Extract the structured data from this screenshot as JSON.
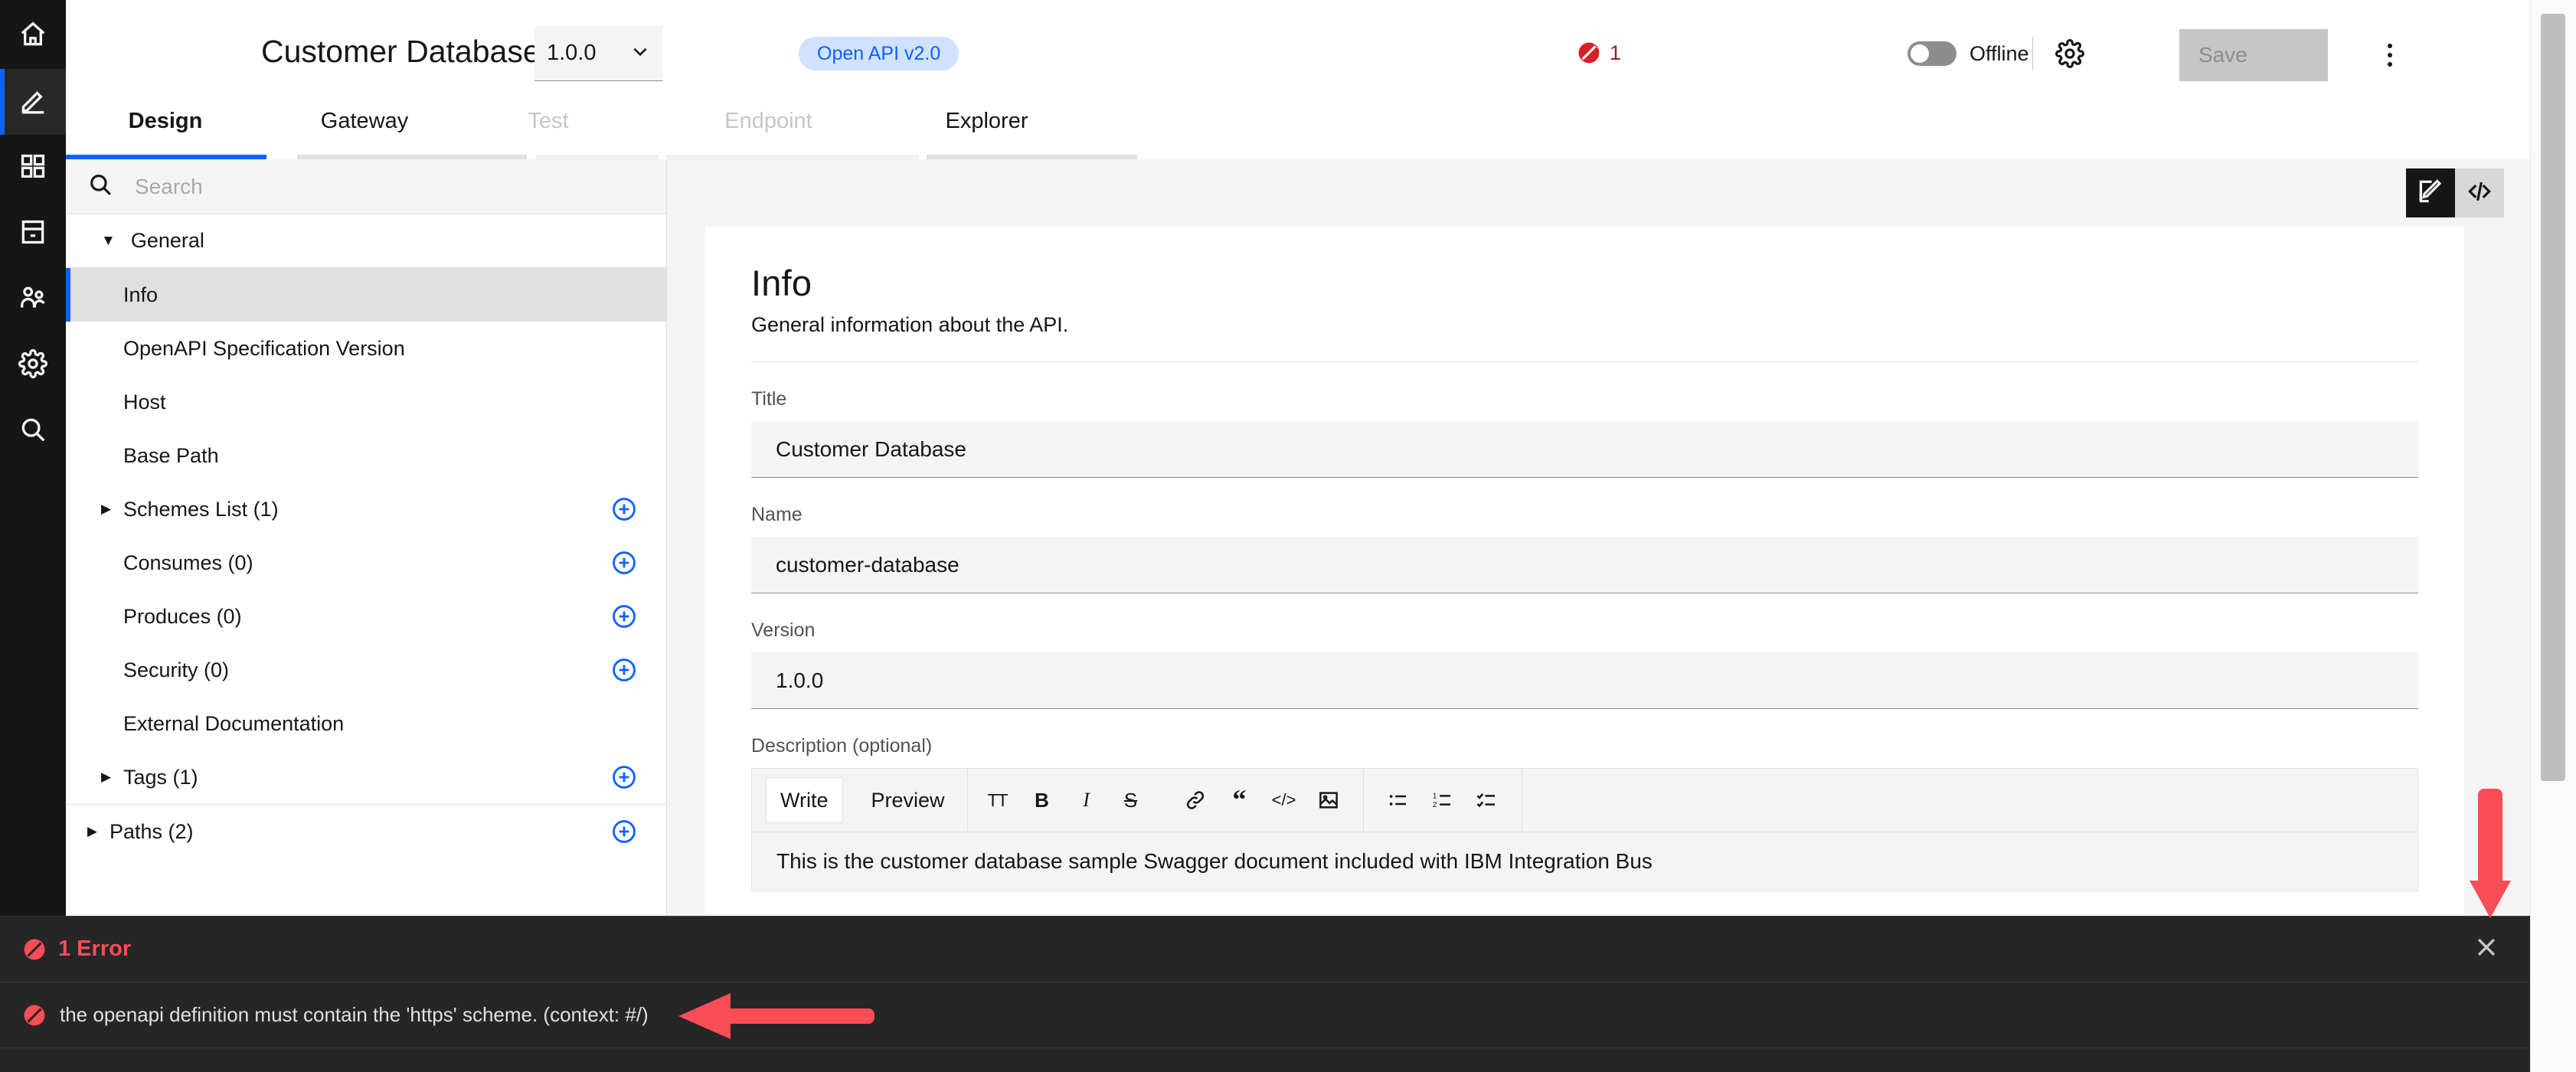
{
  "rail": {
    "items": [
      {
        "name": "home-icon",
        "label": "Home",
        "active": false
      },
      {
        "name": "design-pencil-icon",
        "label": "Design",
        "active": true
      },
      {
        "name": "apps-grid-icon",
        "label": "Apps",
        "active": false
      },
      {
        "name": "catalog-icon",
        "label": "Catalog",
        "active": false
      },
      {
        "name": "members-icon",
        "label": "Members",
        "active": false
      },
      {
        "name": "settings-gear-icon",
        "label": "Settings",
        "active": false
      },
      {
        "name": "search-icon",
        "label": "Search",
        "active": false
      }
    ]
  },
  "header": {
    "api_title": "Customer Database",
    "version_value": "1.0.0",
    "oas_badge": "Open API v2.0",
    "error_count": "1",
    "connection_label": "Offline",
    "connection_on": false,
    "settings_icon": "gear-icon",
    "save_label": "Save",
    "overflow_icon": "kebab-menu-icon"
  },
  "tabs": [
    {
      "label": "Design",
      "state": "active"
    },
    {
      "label": "Gateway",
      "state": "enabled"
    },
    {
      "label": "Test",
      "state": "disabled"
    },
    {
      "label": "Endpoint",
      "state": "disabled"
    },
    {
      "label": "Explorer",
      "state": "enabled"
    }
  ],
  "sidebar": {
    "search": {
      "placeholder": "Search",
      "value": "",
      "icon": "search-icon"
    },
    "groups": [
      {
        "label": "General",
        "expanded": true,
        "items": [
          {
            "label": "Info",
            "selected": true,
            "caret": false,
            "add": false
          },
          {
            "label": "OpenAPI Specification Version",
            "selected": false,
            "caret": false,
            "add": false
          },
          {
            "label": "Host",
            "selected": false,
            "caret": false,
            "add": false
          },
          {
            "label": "Base Path",
            "selected": false,
            "caret": false,
            "add": false
          },
          {
            "label": "Schemes List (1)",
            "selected": false,
            "caret": true,
            "add": true
          },
          {
            "label": "Consumes (0)",
            "selected": false,
            "caret": false,
            "add": true
          },
          {
            "label": "Produces (0)",
            "selected": false,
            "caret": false,
            "add": true
          },
          {
            "label": "Security (0)",
            "selected": false,
            "caret": false,
            "add": true
          },
          {
            "label": "External Documentation",
            "selected": false,
            "caret": false,
            "add": false
          },
          {
            "label": "Tags (1)",
            "selected": false,
            "caret": true,
            "add": true
          }
        ]
      }
    ],
    "footer_items": [
      {
        "label": "Paths (2)",
        "caret": true,
        "add": true
      }
    ]
  },
  "main": {
    "toolbar": {
      "form_view_icon": "edit-form-icon",
      "source_view_icon": "code-brackets-icon"
    },
    "section": {
      "title": "Info",
      "subtitle": "General information about the API."
    },
    "fields": [
      {
        "label": "Title",
        "value": "Customer Database"
      },
      {
        "label": "Name",
        "value": "customer-database"
      },
      {
        "label": "Version",
        "value": "1.0.0"
      }
    ],
    "description": {
      "label": "Description (optional)",
      "tabs": [
        {
          "label": "Write",
          "selected": true
        },
        {
          "label": "Preview",
          "selected": false
        }
      ],
      "tools": [
        {
          "name": "heading-tt-icon",
          "glyph": "TT"
        },
        {
          "name": "bold-icon",
          "glyph": "B"
        },
        {
          "name": "italic-icon",
          "glyph": "I"
        },
        {
          "name": "strikethrough-icon",
          "glyph": "S"
        },
        {
          "name": "link-icon",
          "glyph": "link"
        },
        {
          "name": "quote-icon",
          "glyph": "“"
        },
        {
          "name": "code-icon",
          "glyph": "</>"
        },
        {
          "name": "image-icon",
          "glyph": "image"
        },
        {
          "name": "bulleted-list-icon",
          "glyph": "ul"
        },
        {
          "name": "numbered-list-icon",
          "glyph": "ol"
        },
        {
          "name": "task-list-icon",
          "glyph": "task"
        }
      ],
      "body": "This is the customer database sample Swagger document included with IBM Integration Bus"
    }
  },
  "console": {
    "header_label": "1 Error",
    "close_icon": "close-icon",
    "rows": [
      {
        "message": "the openapi definition must contain the 'https' scheme. (context: #/)"
      }
    ]
  },
  "colors": {
    "accent_blue": "#0f62fe",
    "badge_bg": "#d0e2ff",
    "error_red": "#da1e28",
    "console_bg": "#262626",
    "annotation_red": "#fa4d56"
  }
}
